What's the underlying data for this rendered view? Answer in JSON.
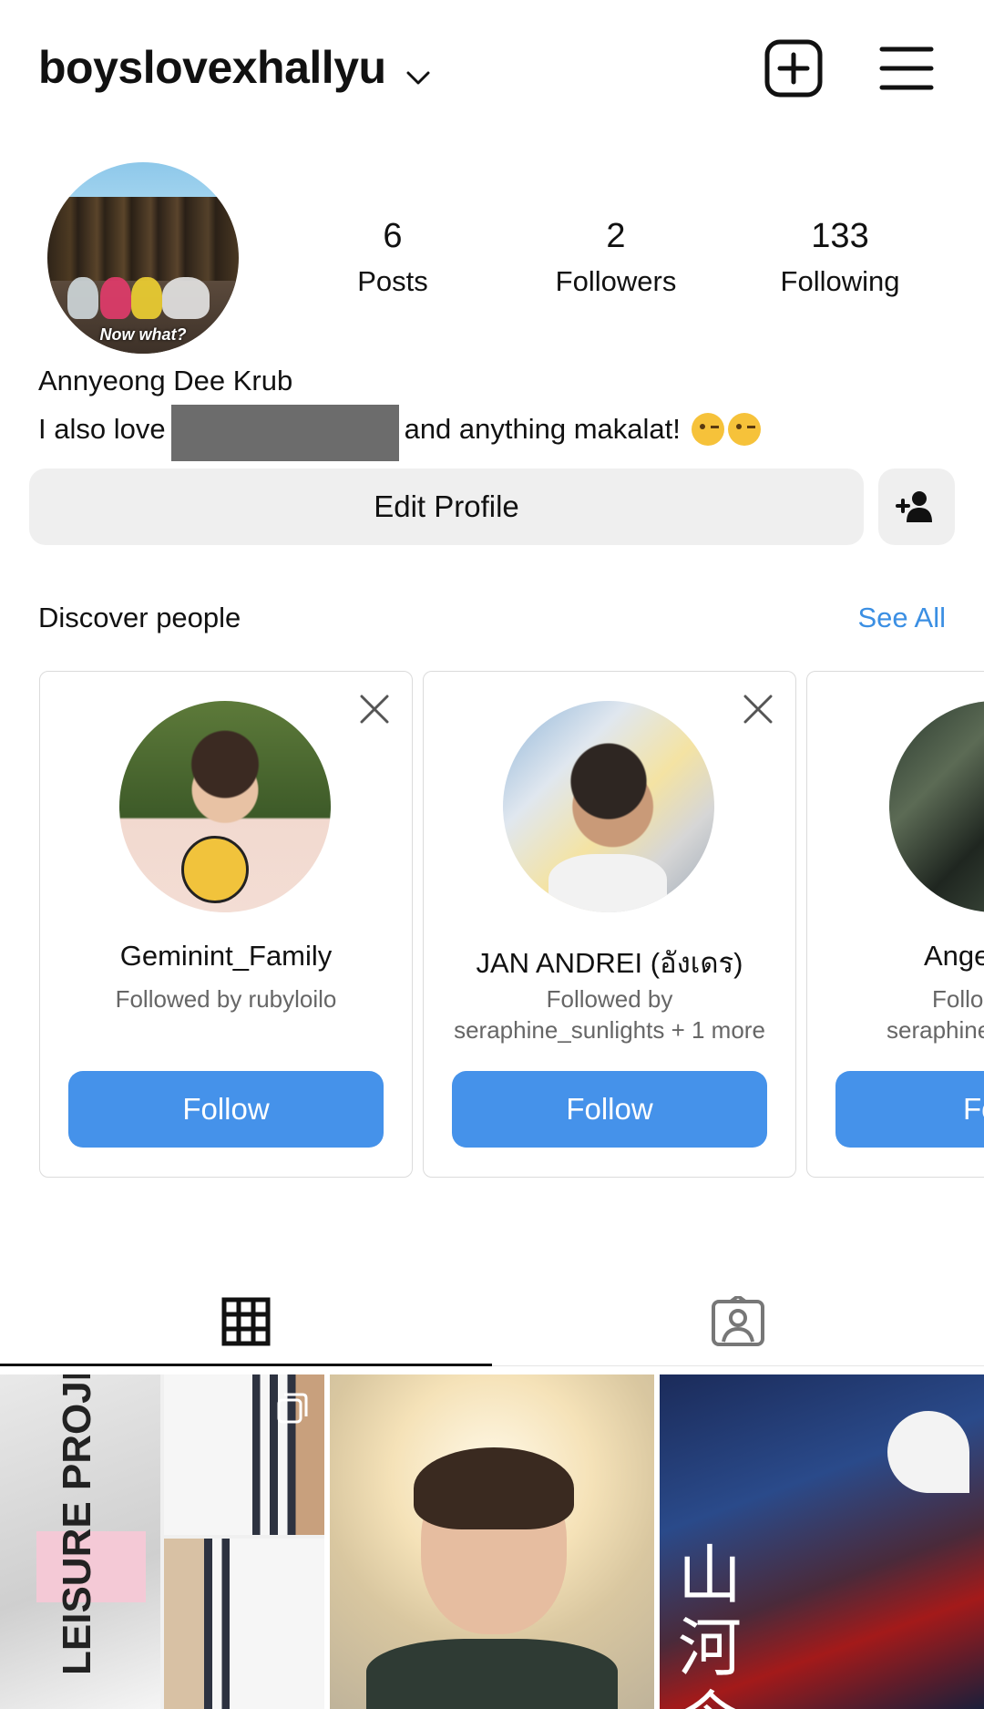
{
  "header": {
    "username": "boyslovexhallyu",
    "icons": [
      "chevron-down-icon",
      "new-post-icon",
      "menu-icon"
    ]
  },
  "profile": {
    "avatar_caption": "Now what?",
    "stats": [
      {
        "value": "6",
        "label": "Posts"
      },
      {
        "value": "2",
        "label": "Followers"
      },
      {
        "value": "133",
        "label": "Following"
      }
    ],
    "bio_name": "Annyeong Dee Krub",
    "bio_prefix": "I also love",
    "bio_suffix": "and anything makalat!",
    "edit_profile_label": "Edit Profile"
  },
  "discover": {
    "title": "Discover people",
    "see_all": "See All",
    "cards": [
      {
        "name": "Geminint_Family",
        "sub1": "Followed by rubyloilo",
        "sub2": "",
        "follow": "Follow"
      },
      {
        "name": "JAN ANDREI (อังเดร)",
        "sub1": "Followed by",
        "sub2": "seraphine_sunlights + 1 more",
        "follow": "Follow"
      },
      {
        "name": "Ange",
        "sub1": "Follo",
        "sub2": "seraphine",
        "follow": "Fo"
      }
    ]
  },
  "tabs": [
    {
      "name": "posts-grid",
      "icon": "grid-icon",
      "active": true
    },
    {
      "name": "tagged",
      "icon": "tagged-icon",
      "active": false
    }
  ],
  "posts": {
    "post1_text": "LEISURE PROJECTS",
    "post3_text": "山河令"
  },
  "colors": {
    "accent": "#4592ea",
    "link": "#3b8fe3",
    "button_bg": "#efefef"
  }
}
